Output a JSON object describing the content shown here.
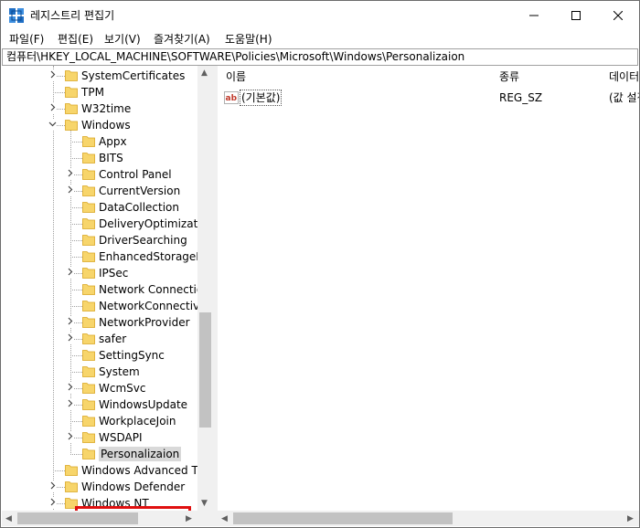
{
  "window": {
    "title": "레지스트리 편집기",
    "minimize_label": "Minimize",
    "maximize_label": "Maximize",
    "close_label": "Close"
  },
  "menu": [
    "파일(F)",
    "편집(E)",
    "보기(V)",
    "즐겨찾기(A)",
    "도움말(H)"
  ],
  "address": "컴퓨터\\HKEY_LOCAL_MACHINE\\SOFTWARE\\Policies\\Microsoft\\Windows\\Personalizaion",
  "tree": {
    "items": [
      {
        "label": "SystemCertificates",
        "level": 0,
        "expander": ">"
      },
      {
        "label": "TPM",
        "level": 0,
        "expander": ""
      },
      {
        "label": "W32time",
        "level": 0,
        "expander": ">"
      },
      {
        "label": "Windows",
        "level": 0,
        "expander": "v"
      },
      {
        "label": "Appx",
        "level": 1,
        "expander": ""
      },
      {
        "label": "BITS",
        "level": 1,
        "expander": ""
      },
      {
        "label": "Control Panel",
        "level": 1,
        "expander": ">"
      },
      {
        "label": "CurrentVersion",
        "level": 1,
        "expander": ">"
      },
      {
        "label": "DataCollection",
        "level": 1,
        "expander": ""
      },
      {
        "label": "DeliveryOptimizatio",
        "level": 1,
        "expander": ""
      },
      {
        "label": "DriverSearching",
        "level": 1,
        "expander": ""
      },
      {
        "label": "EnhancedStorageDe",
        "level": 1,
        "expander": ""
      },
      {
        "label": "IPSec",
        "level": 1,
        "expander": ">"
      },
      {
        "label": "Network Connection",
        "level": 1,
        "expander": ""
      },
      {
        "label": "NetworkConnectivit",
        "level": 1,
        "expander": ""
      },
      {
        "label": "NetworkProvider",
        "level": 1,
        "expander": ">"
      },
      {
        "label": "safer",
        "level": 1,
        "expander": ">"
      },
      {
        "label": "SettingSync",
        "level": 1,
        "expander": ""
      },
      {
        "label": "System",
        "level": 1,
        "expander": ""
      },
      {
        "label": "WcmSvc",
        "level": 1,
        "expander": ">"
      },
      {
        "label": "WindowsUpdate",
        "level": 1,
        "expander": ">"
      },
      {
        "label": "WorkplaceJoin",
        "level": 1,
        "expander": ""
      },
      {
        "label": "WSDAPI",
        "level": 1,
        "expander": ">"
      },
      {
        "label": "Personalizaion",
        "level": 1,
        "expander": "",
        "selected": true
      },
      {
        "label": "Windows Advanced Thr",
        "level": 0,
        "expander": ""
      },
      {
        "label": "Windows Defender",
        "level": 0,
        "expander": ">"
      },
      {
        "label": "Windows NT",
        "level": 0,
        "expander": ">"
      }
    ]
  },
  "list": {
    "columns": [
      "이름",
      "종류",
      "데이터"
    ],
    "rows": [
      {
        "name": "(기본값)",
        "type": "REG_SZ",
        "data": "(값 설정 안 됨)"
      }
    ]
  },
  "colors": {
    "folder": "#f7d56b",
    "folder_edge": "#d9a520",
    "highlight": "#e01010",
    "selection": "#d9d9d9"
  }
}
